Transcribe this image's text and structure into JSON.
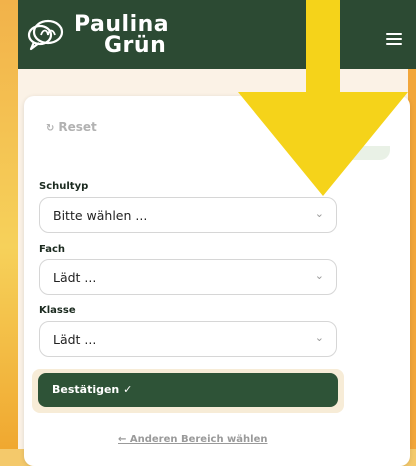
{
  "brand": {
    "line1": "Paulina",
    "line2": "Grün"
  },
  "icons": {
    "logo": "speech-bubbles-logo-icon",
    "menu": "hamburger-menu-icon",
    "reset": "reset-rotate-icon",
    "chevron": "chevron-down-icon",
    "arrow": "down-arrow-overlay"
  },
  "form": {
    "reset_label": "Reset",
    "reset_icon_glyph": "↻",
    "fields": [
      {
        "label": "Schultyp",
        "value": "Bitte wählen ..."
      },
      {
        "label": "Fach",
        "value": "Lädt ..."
      },
      {
        "label": "Klasse",
        "value": "Lädt ..."
      }
    ],
    "chevron_glyph": "⌄",
    "confirm_label": "Bestätigen ✓",
    "back_link": "← Anderen Bereich wählen"
  },
  "colors": {
    "header": "#2c4a33",
    "confirm": "#2e5337",
    "arrow": "#f5d31a"
  }
}
